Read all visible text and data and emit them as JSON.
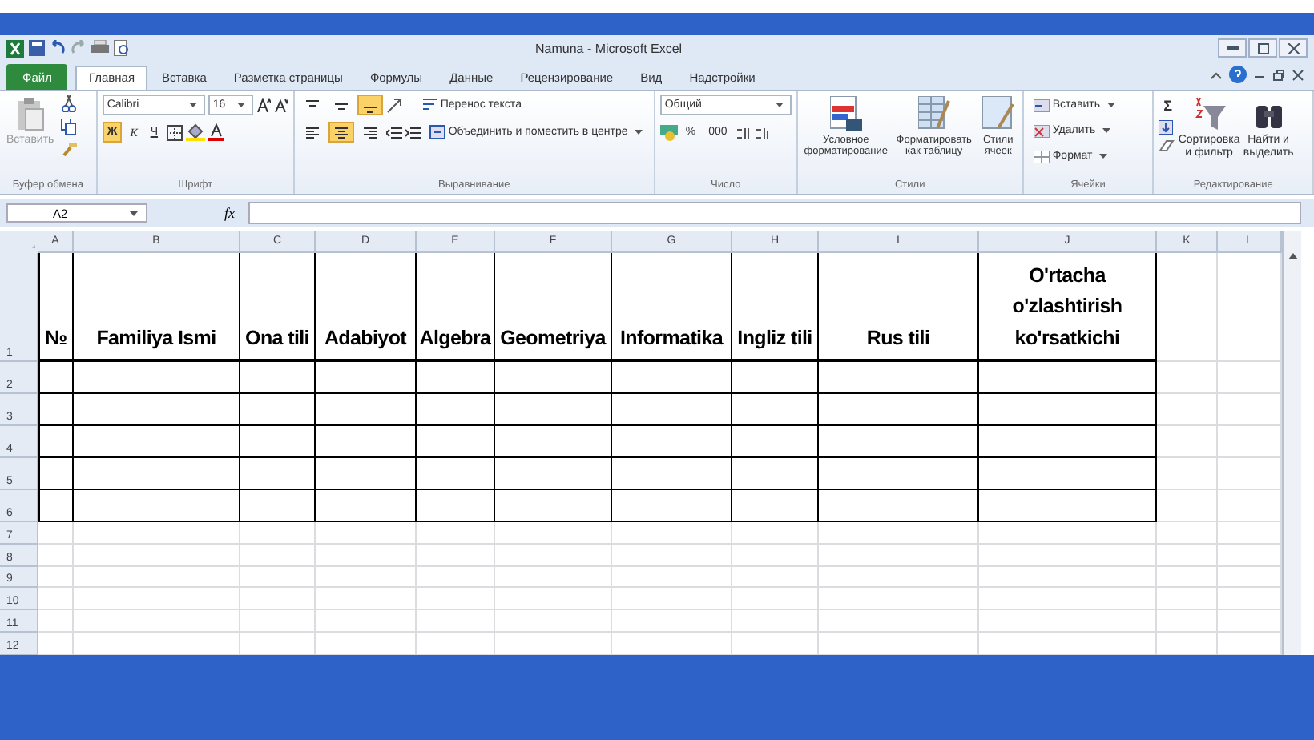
{
  "window": {
    "title": "Namuna - Microsoft Excel"
  },
  "tabs": [
    {
      "label": "Файл",
      "kind": "file",
      "selected": false
    },
    {
      "label": "Главная",
      "kind": "tab",
      "selected": true
    },
    {
      "label": "Вставка",
      "kind": "tab",
      "selected": false
    },
    {
      "label": "Разметка страницы",
      "kind": "tab",
      "selected": false
    },
    {
      "label": "Формулы",
      "kind": "tab",
      "selected": false
    },
    {
      "label": "Данные",
      "kind": "tab",
      "selected": false
    },
    {
      "label": "Рецензирование",
      "kind": "tab",
      "selected": false
    },
    {
      "label": "Вид",
      "kind": "tab",
      "selected": false
    },
    {
      "label": "Надстройки",
      "kind": "tab",
      "selected": false
    }
  ],
  "ribbon": {
    "clipboard": {
      "label": "Буфер обмена",
      "paste": "Вставить"
    },
    "font": {
      "label": "Шрифт",
      "name": "Calibri",
      "size": "16",
      "bold": {
        "text": "Ж",
        "on": true
      },
      "italic": {
        "text": "К",
        "on": false
      },
      "underline": {
        "text": "Ч",
        "on": false
      }
    },
    "alignment": {
      "label": "Выравнивание",
      "wrap": "Перенос текста",
      "merge": "Объединить и поместить в центре",
      "valign": [
        {
          "on": false
        },
        {
          "on": false
        },
        {
          "on": true
        }
      ],
      "halign": [
        {
          "on": false
        },
        {
          "on": true
        },
        {
          "on": false
        }
      ]
    },
    "number": {
      "label": "Число",
      "format": "Общий",
      "percent": "%",
      "thousands": "000"
    },
    "styles": {
      "label": "Стили",
      "conditional": "Условное форматирование",
      "table": "Форматировать как таблицу",
      "cell_styles": "Стили ячеек"
    },
    "cells": {
      "label": "Ячейки",
      "insert": "Вставить",
      "delete": "Удалить",
      "format": "Формат"
    },
    "editing": {
      "label": "Редактирование",
      "sum": "Σ",
      "sort": "Сортировка и фильтр",
      "find": "Найти и выделить"
    }
  },
  "formula_bar": {
    "name_box": "A2",
    "fx": "fx"
  },
  "sheet": {
    "columns": [
      "A",
      "B",
      "C",
      "D",
      "E",
      "F",
      "G",
      "H",
      "I",
      "J",
      "K",
      "L"
    ],
    "rows": [
      {
        "number": "1",
        "kind": "header",
        "cells": [
          "№",
          "Familiya Ismi",
          "Ona tili",
          "Adabiyot",
          "Algebra",
          "Geometriya",
          "Informatika",
          "Ingliz tili",
          "Rus tili",
          "O'rtacha o'zlashtirish ko'rsatkichi"
        ]
      },
      {
        "number": "2",
        "kind": "table"
      },
      {
        "number": "3",
        "kind": "table"
      },
      {
        "number": "4",
        "kind": "table"
      },
      {
        "number": "5",
        "kind": "table"
      },
      {
        "number": "6",
        "kind": "table"
      },
      {
        "number": "7",
        "kind": "blank"
      },
      {
        "number": "8",
        "kind": "blank"
      },
      {
        "number": "9",
        "kind": "blank"
      },
      {
        "number": "10",
        "kind": "blank"
      },
      {
        "number": "11",
        "kind": "blank"
      },
      {
        "number": "12",
        "kind": "blank"
      }
    ]
  }
}
